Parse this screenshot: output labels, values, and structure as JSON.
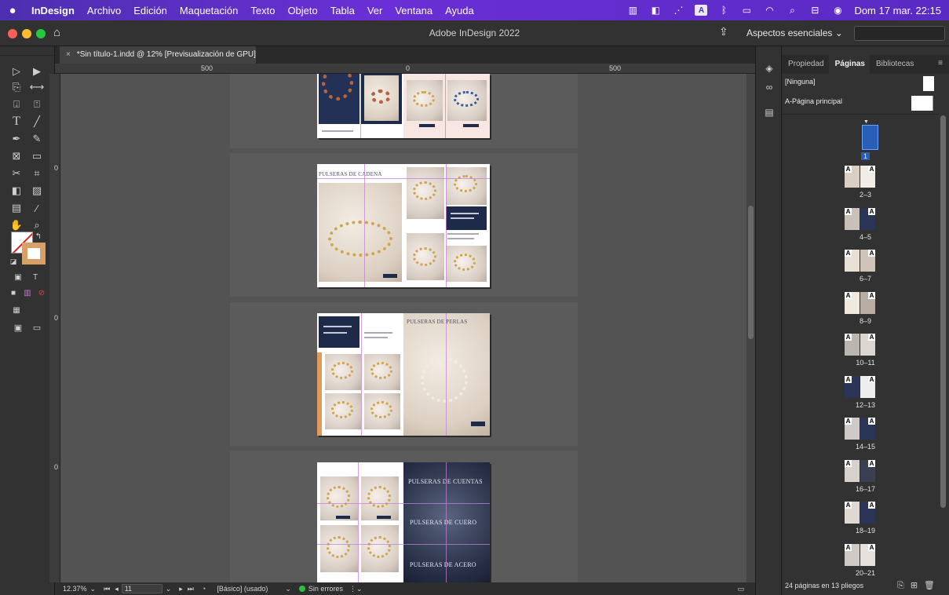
{
  "menubar": {
    "apple": "",
    "app_name": "InDesign",
    "items": [
      "Archivo",
      "Edición",
      "Maquetación",
      "Texto",
      "Objeto",
      "Tabla",
      "Ver",
      "Ventana",
      "Ayuda"
    ],
    "date_time": "Dom 17 mar.  22:15",
    "status_icons": [
      "barcode-icon",
      "chat-icon",
      "feather-icon",
      "text-input-icon",
      "bluetooth-icon",
      "battery-icon",
      "wifi-icon",
      "search-icon",
      "control-center-icon",
      "siri-icon"
    ]
  },
  "appbar": {
    "title": "Adobe InDesign 2022",
    "workspace": "Aspectos esenciales",
    "workspace_chevron": "⌄",
    "search_placeholder": ""
  },
  "document": {
    "tab_title": "*Sin título-1.indd @ 12% [Previsualización de GPU]",
    "close": "×"
  },
  "ruler": {
    "h_labels": [
      "500",
      "0",
      "500"
    ],
    "v_labels": [
      "0",
      "0",
      "0"
    ]
  },
  "canvas": {
    "headings": {
      "cadena": "PULSERAS DE CADENA",
      "perlas": "PULSERAS DE PERLAS",
      "cuentas": "PULSERAS DE CUENTAS",
      "cuero": "PULSERAS DE CUERO",
      "acero": "PULSERAS DE ACERO"
    }
  },
  "statusbar": {
    "zoom": "12.37%",
    "page": "11",
    "style": "[Básico] (usado)",
    "preflight": "Sin errores"
  },
  "panel": {
    "tabs": [
      "Propiedad",
      "Páginas",
      "Bibliotecas"
    ],
    "active_tab": "Páginas",
    "masters": [
      "[Ninguna]",
      "A-Página principal"
    ],
    "thumb_labels": [
      "1",
      "2–3",
      "4–5",
      "6–7",
      "8–9",
      "10–11",
      "12–13",
      "14–15",
      "16–17",
      "18–19",
      "20–21"
    ],
    "footer": "24 páginas en 13 pliegos"
  },
  "colors": {
    "menubar": "#5a2ac4",
    "navy": "#1e2a4a",
    "gold": "#d1a44e",
    "guide": "#c27fd8",
    "ok_dot": "#2fbf3c"
  }
}
